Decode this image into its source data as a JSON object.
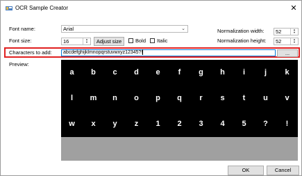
{
  "window": {
    "title": "OCR Sample Creator",
    "icon": "app-icon",
    "close_symbol": "✕"
  },
  "font_name": {
    "label": "Font name:",
    "value": "Arial"
  },
  "font_size": {
    "label": "Font size:",
    "value": "16",
    "adjust_button": "Adjust size",
    "bold_label": "Bold",
    "bold_checked": false,
    "italic_label": "Italic",
    "italic_checked": false
  },
  "normalization": {
    "width_label": "Normalization width:",
    "width_value": "52",
    "height_label": "Normalization height:",
    "height_value": "52"
  },
  "characters": {
    "label": "Characters to add:",
    "value": "abcdefghijklmnopqrstuvwxyz12345?!",
    "browse_button": "..."
  },
  "preview": {
    "label": "Preview:",
    "rows": [
      [
        "a",
        "b",
        "c",
        "d",
        "e",
        "f",
        "g",
        "h",
        "i",
        "j",
        "k"
      ],
      [
        "l",
        "m",
        "n",
        "o",
        "p",
        "q",
        "r",
        "s",
        "t",
        "u",
        "v"
      ],
      [
        "w",
        "x",
        "y",
        "z",
        "1",
        "2",
        "3",
        "4",
        "5",
        "?",
        "!"
      ]
    ]
  },
  "buttons": {
    "ok": "OK",
    "cancel": "Cancel"
  },
  "colors": {
    "highlight_border": "#e02020",
    "preview_bg": "#000000",
    "preview_area": "#a0a0a0"
  }
}
